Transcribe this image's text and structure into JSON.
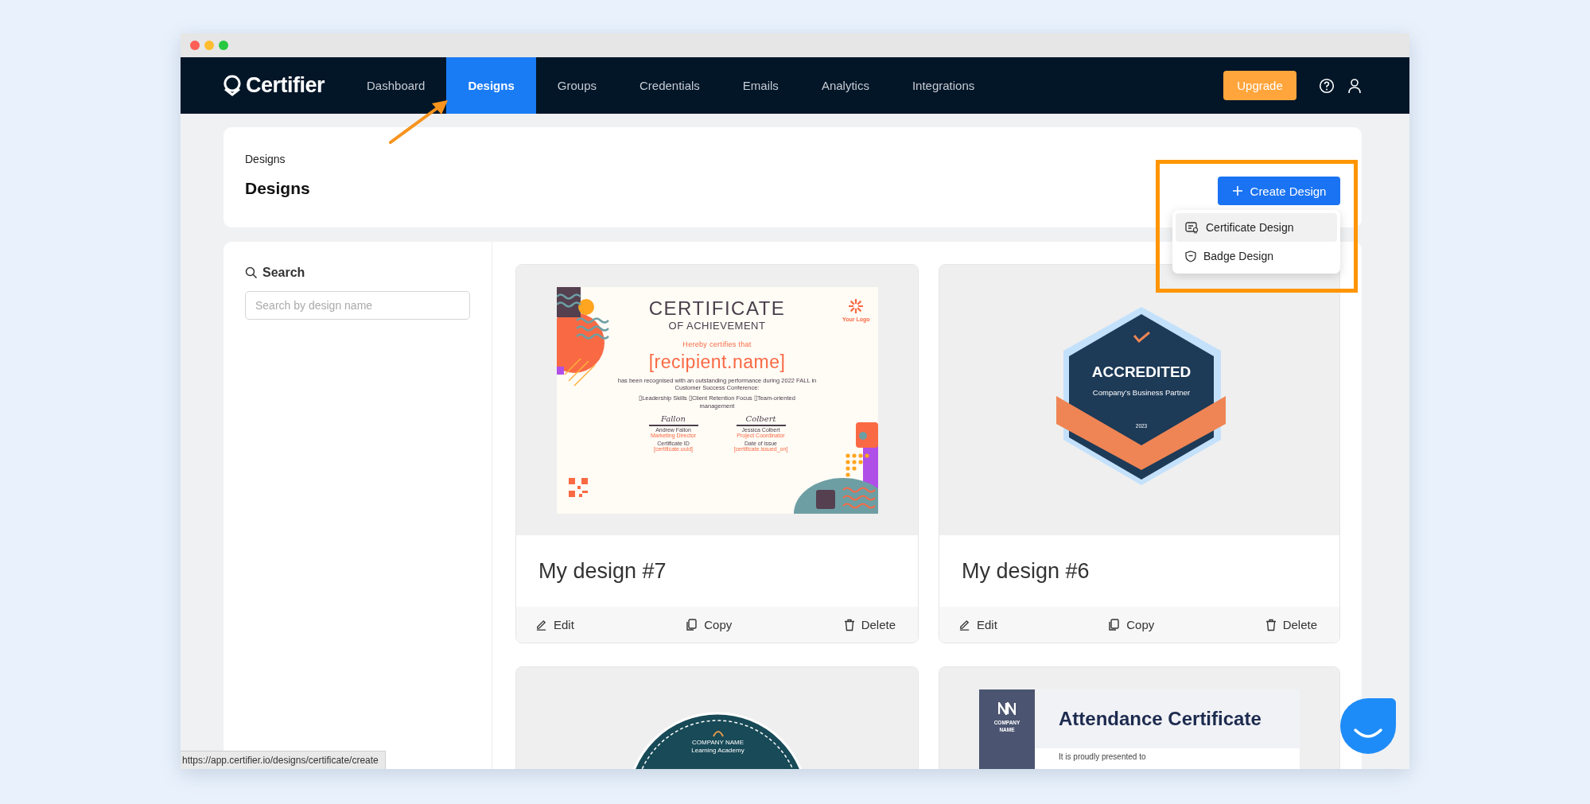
{
  "nav": {
    "logo": "Certifier",
    "items": [
      {
        "label": "Dashboard",
        "selected": false
      },
      {
        "label": "Designs",
        "selected": true
      },
      {
        "label": "Groups",
        "selected": false
      },
      {
        "label": "Credentials",
        "selected": false
      },
      {
        "label": "Emails",
        "selected": false
      },
      {
        "label": "Analytics",
        "selected": false
      },
      {
        "label": "Integrations",
        "selected": false
      }
    ],
    "upgrade": "Upgrade"
  },
  "header": {
    "breadcrumb": "Designs",
    "title": "Designs",
    "create_button": "Create Design",
    "create_menu": [
      {
        "label": "Certificate Design",
        "kind": "certificate",
        "selected": true
      },
      {
        "label": "Badge Design",
        "kind": "badge",
        "selected": false
      }
    ]
  },
  "search": {
    "label": "Search",
    "placeholder": "Search by design name"
  },
  "designs": [
    {
      "name": "My design #7",
      "preview": {
        "kind": "certificate",
        "title": "CERTIFICATE",
        "subtitle": "OF ACHIEVEMENT",
        "logo": "Your Logo",
        "intro": "Hereby certifies that",
        "recipient": "[recipient.name]",
        "body": "has been recognised with an outstanding performance during 2022 FALL in Customer Success Conference:",
        "skills": "▯Leadership Skills ▯Client Retention Focus ▯Team-oriented management",
        "signatures": [
          {
            "signature": "Fallon",
            "name": "Andrew Fallon",
            "role": "Marketing Director",
            "field": "Certificate ID",
            "value": "[certificate.uuid]"
          },
          {
            "signature": "Colbert",
            "name": "Jessica Colbert",
            "role": "Project Coordinator",
            "field": "Date of issue",
            "value": "[certificate.issued_on]"
          }
        ]
      },
      "actions": [
        {
          "kind": "edit",
          "label": "Edit"
        },
        {
          "kind": "copy",
          "label": "Copy"
        },
        {
          "kind": "delete",
          "label": "Delete"
        }
      ]
    },
    {
      "name": "My design #6",
      "preview": {
        "kind": "badge",
        "title": "ACCREDITED",
        "subtitle": "Company’s Business Partner",
        "year": "2023"
      },
      "actions": [
        {
          "kind": "edit",
          "label": "Edit"
        },
        {
          "kind": "copy",
          "label": "Copy"
        },
        {
          "kind": "delete",
          "label": "Delete"
        }
      ]
    },
    {
      "preview": {
        "kind": "round-badge",
        "company": "COMPANY NAME",
        "academy": "Learning Academy"
      }
    },
    {
      "preview": {
        "kind": "attendance",
        "company": "COMPANY NAME",
        "title": "Attendance Certificate",
        "intro": "It is proudly presented to"
      }
    }
  ],
  "status_bar": {
    "url": "https://app.certifier.io/designs/certificate/create"
  }
}
